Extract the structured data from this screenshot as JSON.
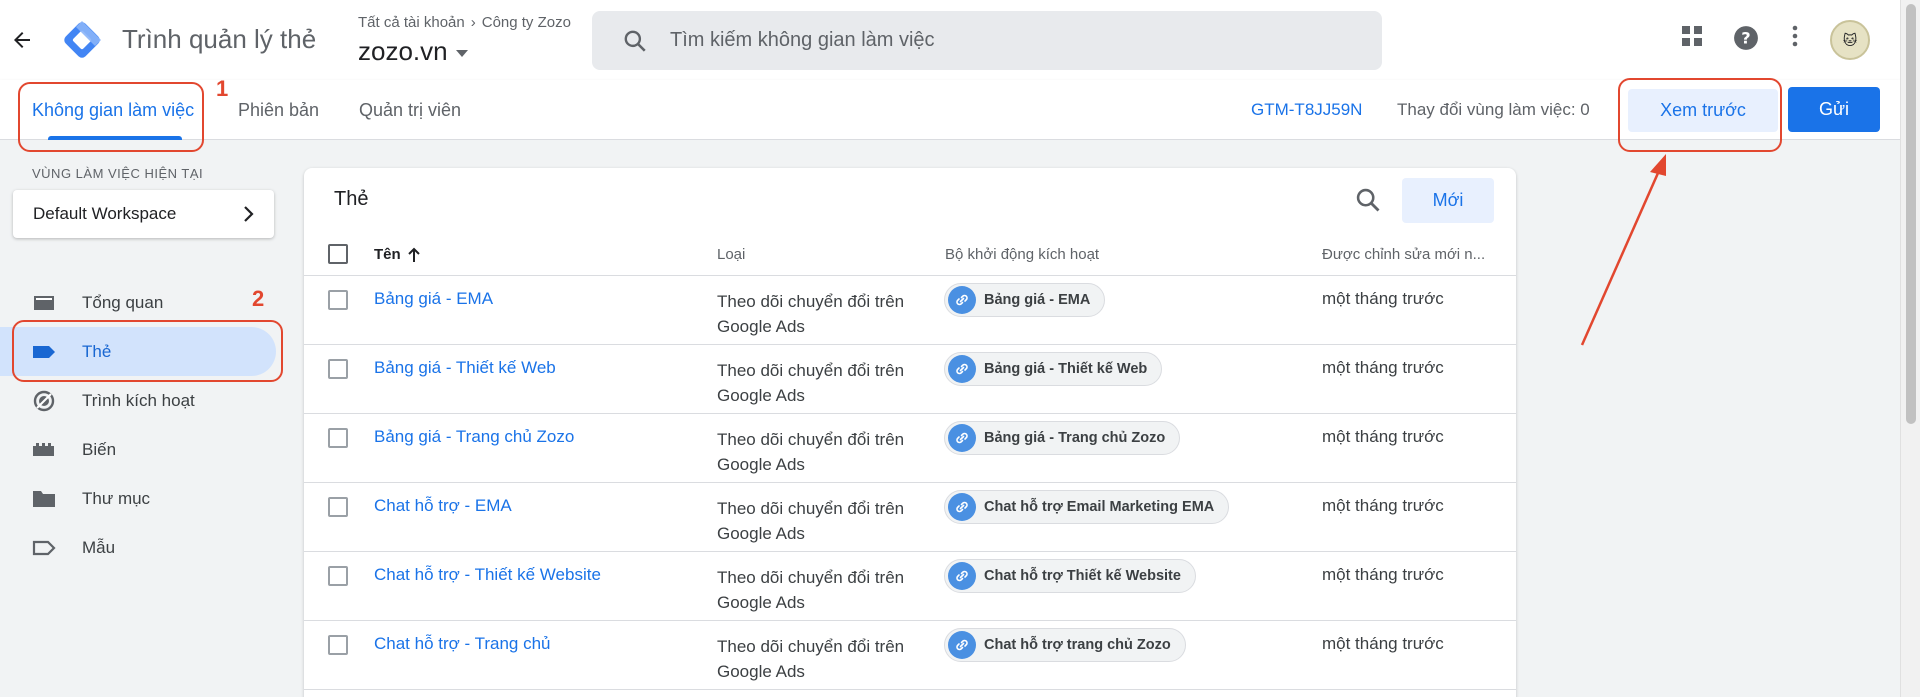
{
  "header": {
    "app_title": "Trình quản lý thẻ",
    "breadcrumb_all": "Tất cả tài khoản",
    "breadcrumb_company": "Công ty Zozo",
    "container_name": "zozo.vn",
    "search_placeholder": "Tìm kiếm không gian làm việc"
  },
  "nav": {
    "tabs": [
      {
        "label": "Không gian làm việc",
        "active": true
      },
      {
        "label": "Phiên bản",
        "active": false
      },
      {
        "label": "Quản trị viên",
        "active": false
      }
    ],
    "container_id": "GTM-T8JJ59N",
    "workspace_changes": "Thay đổi vùng làm việc: 0",
    "preview_label": "Xem trước",
    "submit_label": "Gửi"
  },
  "annotations": {
    "num1": "1",
    "num2": "2"
  },
  "sidebar": {
    "workspace_heading": "VÙNG LÀM VIỆC HIỆN TẠI",
    "workspace_name": "Default Workspace",
    "items": [
      {
        "label": "Tổng quan",
        "icon": "overview-icon"
      },
      {
        "label": "Thẻ",
        "icon": "tag-icon",
        "active": true
      },
      {
        "label": "Trình kích hoạt",
        "icon": "trigger-icon"
      },
      {
        "label": "Biến",
        "icon": "variable-icon"
      },
      {
        "label": "Thư mục",
        "icon": "folder-icon"
      },
      {
        "label": "Mẫu",
        "icon": "template-icon"
      }
    ]
  },
  "tags_card": {
    "title": "Thẻ",
    "new_label": "Mới",
    "columns": {
      "name": "Tên",
      "type": "Loại",
      "trigger": "Bộ khởi động kích hoạt",
      "edited": "Được chỉnh sửa mới n..."
    },
    "rows": [
      {
        "name": "Bảng giá - EMA",
        "type": "Theo dõi chuyển đổi trên Google Ads",
        "trigger": "Bảng giá - EMA",
        "edited": "một tháng trước"
      },
      {
        "name": "Bảng giá - Thiết kế Web",
        "type": "Theo dõi chuyển đổi trên Google Ads",
        "trigger": "Bảng giá - Thiết kế Web",
        "edited": "một tháng trước"
      },
      {
        "name": "Bảng giá - Trang chủ Zozo",
        "type": "Theo dõi chuyển đổi trên Google Ads",
        "trigger": "Bảng giá - Trang chủ Zozo",
        "edited": "một tháng trước"
      },
      {
        "name": "Chat hỗ trợ - EMA",
        "type": "Theo dõi chuyển đổi trên Google Ads",
        "trigger": "Chat hỗ trợ Email Marketing EMA",
        "edited": "một tháng trước"
      },
      {
        "name": "Chat hỗ trợ - Thiết kế Website",
        "type": "Theo dõi chuyển đổi trên Google Ads",
        "trigger": "Chat hỗ trợ Thiết kế Website",
        "edited": "một tháng trước"
      },
      {
        "name": "Chat hỗ trợ - Trang chủ",
        "type": "Theo dõi chuyển đổi trên Google Ads",
        "trigger": "Chat hỗ trợ trang chủ Zozo",
        "edited": "một tháng trước"
      }
    ]
  },
  "colors": {
    "accent": "#1a73e8",
    "annotation": "#e2472f",
    "active_nav_bg": "#d2e3fc"
  }
}
